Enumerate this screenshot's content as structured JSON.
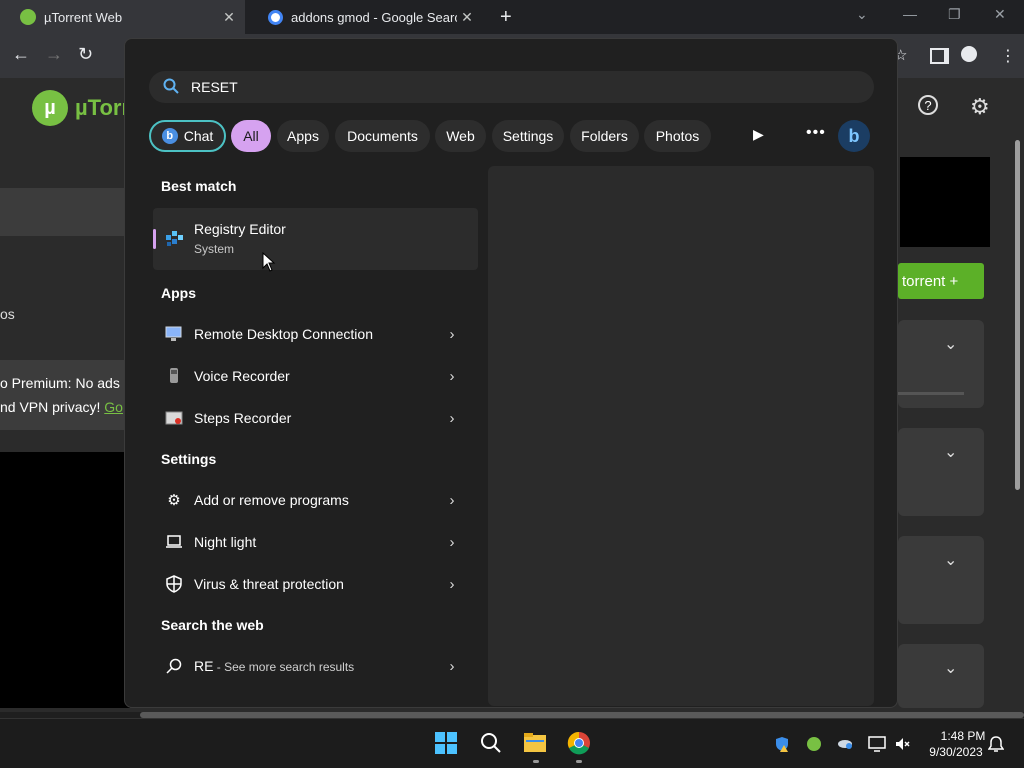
{
  "browser": {
    "tabs": [
      {
        "title": "µTorrent Web",
        "favicon": "utorrent-icon",
        "color": "#78c043"
      },
      {
        "title": "addons gmod - Google Search",
        "favicon": "google-icon",
        "color": "#4285f4"
      }
    ],
    "new_tab_icon": "+",
    "window_controls": {
      "minimize": "—",
      "restore": "❐",
      "close": "✕"
    },
    "nav": {
      "back": "←",
      "forward": "→",
      "reload": "↻"
    },
    "toolbar_icons": [
      "star-icon",
      "sidebar-icon",
      "profile-icon",
      "menu-icon"
    ]
  },
  "utorrent": {
    "brand": "µTorr",
    "side_text": "os",
    "promo_line1": "o Premium: No ads",
    "promo_line2": "nd VPN privacy!",
    "promo_link": "Go",
    "add_torrent": "torrent  +",
    "colors": {
      "green": "#78c043",
      "button": "#5cb028"
    }
  },
  "search": {
    "query": "RESET",
    "filters": [
      {
        "label": "Chat"
      },
      {
        "label": "All"
      },
      {
        "label": "Apps"
      },
      {
        "label": "Documents"
      },
      {
        "label": "Web"
      },
      {
        "label": "Settings"
      },
      {
        "label": "Folders"
      },
      {
        "label": "Photos"
      }
    ],
    "best_match_heading": "Best match",
    "best_match": {
      "title": "Registry Editor",
      "subtitle": "System",
      "icon": "registry-editor-icon"
    },
    "apps_heading": "Apps",
    "apps": [
      {
        "label": "Remote Desktop Connection",
        "icon": "remote-desktop-icon"
      },
      {
        "label": "Voice Recorder",
        "icon": "microphone-icon"
      },
      {
        "label": "Steps Recorder",
        "icon": "steps-recorder-icon"
      }
    ],
    "settings_heading": "Settings",
    "settings": [
      {
        "label": "Add or remove programs",
        "icon": "gear-icon"
      },
      {
        "label": "Night light",
        "icon": "laptop-icon"
      },
      {
        "label": "Virus & threat protection",
        "icon": "shield-icon"
      }
    ],
    "web_heading": "Search the web",
    "web": {
      "term": "RE",
      "suffix": " - See more search results",
      "icon": "search-icon"
    },
    "accent": "#d6a2f0"
  },
  "taskbar": {
    "pinned": [
      "start-icon",
      "search-icon",
      "file-explorer-icon",
      "chrome-icon"
    ],
    "tray": [
      "defender-warning-icon",
      "utorrent-tray-icon",
      "onedrive-icon",
      "display-icon",
      "mute-icon"
    ],
    "time": "1:48 PM",
    "date": "9/30/2023"
  }
}
